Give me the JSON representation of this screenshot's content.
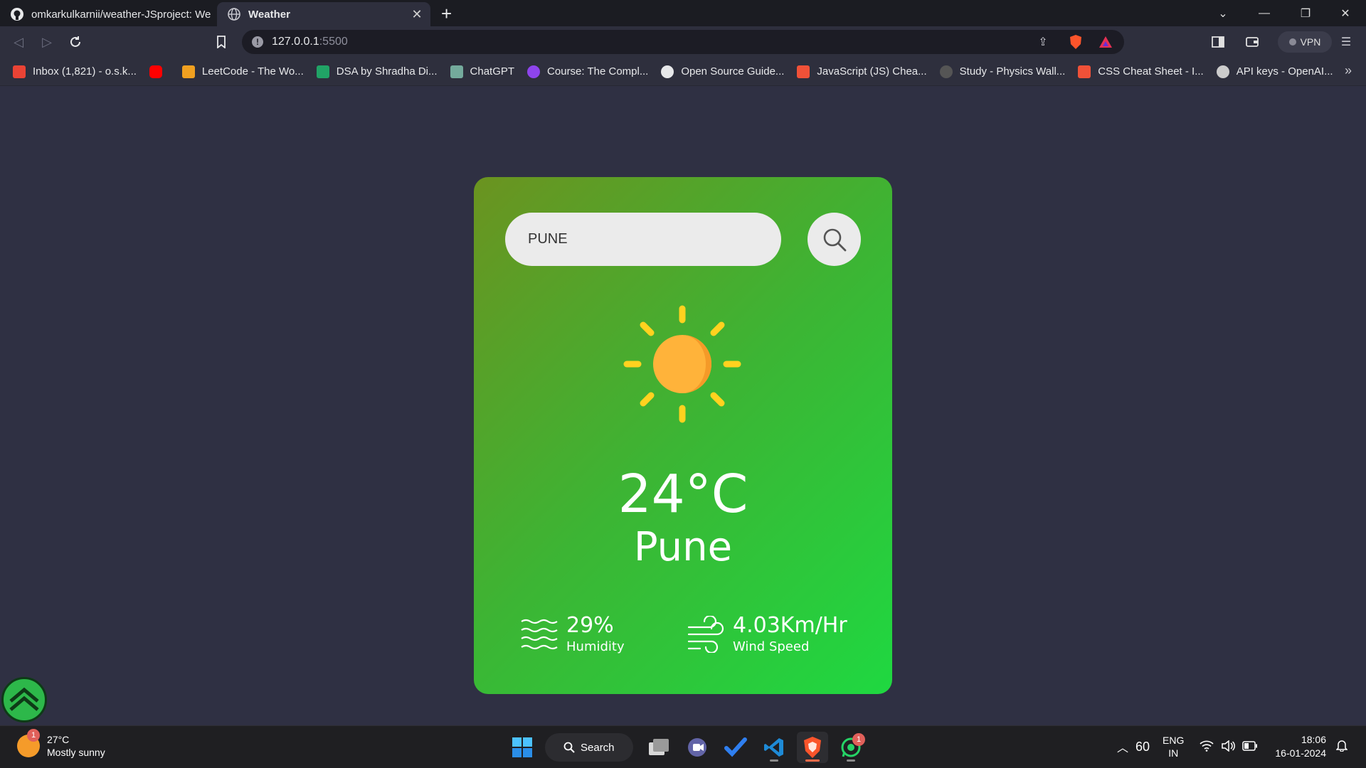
{
  "browser": {
    "tabs": [
      {
        "title": "omkarkulkarnii/weather-JSproject: We",
        "active": false
      },
      {
        "title": "Weather",
        "active": true
      }
    ],
    "url_host": "127.0.0.1",
    "url_port": ":5500",
    "vpn_label": "VPN",
    "bookmarks": [
      {
        "label": "Inbox (1,821) - o.s.k...",
        "color": "#ea4335"
      },
      {
        "label": "",
        "color": "#ff0000"
      },
      {
        "label": "LeetCode - The Wo...",
        "color": "#f0a020"
      },
      {
        "label": "DSA by Shradha Di...",
        "color": "#21a366"
      },
      {
        "label": "ChatGPT",
        "color": "#74aa9c"
      },
      {
        "label": "Course: The Compl...",
        "color": "#8e44ec"
      },
      {
        "label": "Open Source Guide...",
        "color": "#e7e8ea"
      },
      {
        "label": "JavaScript (JS) Chea...",
        "color": "#f05138"
      },
      {
        "label": "Study - Physics Wall...",
        "color": "#555555"
      },
      {
        "label": "CSS Cheat Sheet - I...",
        "color": "#f05138"
      },
      {
        "label": "API keys - OpenAI...",
        "color": "#cccccc"
      }
    ],
    "more_bookmarks": "»"
  },
  "weather": {
    "search_value": "PUNE",
    "temperature": "24°C",
    "city": "Pune",
    "humidity_value": "29%",
    "humidity_label": "Humidity",
    "wind_value": "4.03Km/Hr",
    "wind_label": "Wind Speed",
    "icon": "sun-icon"
  },
  "taskbar": {
    "weather_temp": "27°C",
    "weather_desc": "Mostly sunny",
    "weather_badge": "1",
    "search_label": "Search",
    "whatsapp_badge": "1",
    "tray_number": "60",
    "lang_line1": "ENG",
    "lang_line2": "IN",
    "time": "18:06",
    "date": "16-01-2024"
  }
}
